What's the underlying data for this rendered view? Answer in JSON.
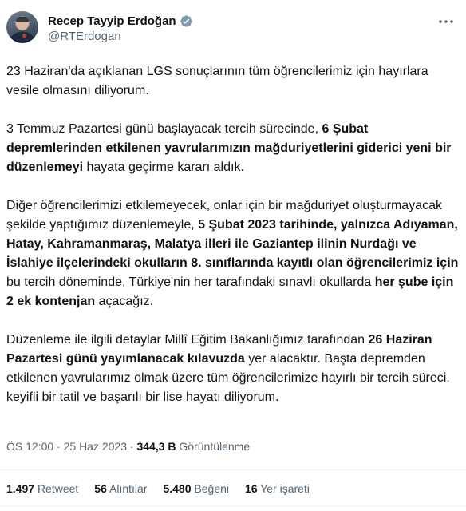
{
  "author": {
    "display_name": "Recep Tayyip Erdoğan",
    "handle": "@RTErdogan",
    "verified_icon": "verified-badge-icon",
    "accent": "#829aab"
  },
  "tweet": {
    "p1": "23 Haziran'da açıklanan LGS sonuçlarının tüm öğrencilerimiz için hayırlara vesile olmasını diliyorum.",
    "p2": {
      "t1": "3 Temmuz Pazartesi günü başlayacak tercih sürecinde, ",
      "b1": "6 Şubat depremlerinden etkilenen yavrularımızın mağduriyetlerini giderici yeni bir düzenlemeyi",
      "t2": " hayata geçirme kararı aldık."
    },
    "p3": {
      "t1": "Diğer öğrencilerimizi etkilemeyecek, onlar için bir mağduriyet oluşturmayacak şekilde yaptığımız düzenlemeyle, ",
      "b1": "5 Şubat 2023 tarihinde, yalnızca Adıyaman, Hatay, Kahramanmaraş, Malatya illeri ile Gaziantep ilinin Nurdağı ve İslahiye ilçelerindeki okulların 8. sınıflarında kayıtlı olan öğrencilerimiz için",
      "t2": " bu tercih döneminde, Türkiye'nin her tarafındaki sınavlı okullarda ",
      "b2": "her şube için 2 ek kontenjan",
      "t3": " açacağız."
    },
    "p4": {
      "t1": "Düzenleme ile ilgili detaylar Millî Eğitim Bakanlığımız tarafından ",
      "b1": "26 Haziran Pazartesi günü yayımlanacak kılavuzda",
      "t2": " yer alacaktır. Başta depremden etkilenen yavrularımız olmak üzere tüm öğrencilerimize hayırlı bir tercih süreci, keyifli bir tatil ve başarılı bir lise hayatı diliyorum."
    }
  },
  "meta": {
    "time": "ÖS 12:00",
    "sep": " · ",
    "date": "25 Haz 2023",
    "views_count": "344,3 B",
    "views_label": "Görüntülenme"
  },
  "stats": {
    "retweets_count": "1.497",
    "retweets_label": "Retweet",
    "quotes_count": "56",
    "quotes_label": "Alıntılar",
    "likes_count": "5.480",
    "likes_label": "Beğeni",
    "bookmarks_count": "16",
    "bookmarks_label": "Yer işareti"
  },
  "icons": {
    "more": "more-horizontal-icon"
  }
}
